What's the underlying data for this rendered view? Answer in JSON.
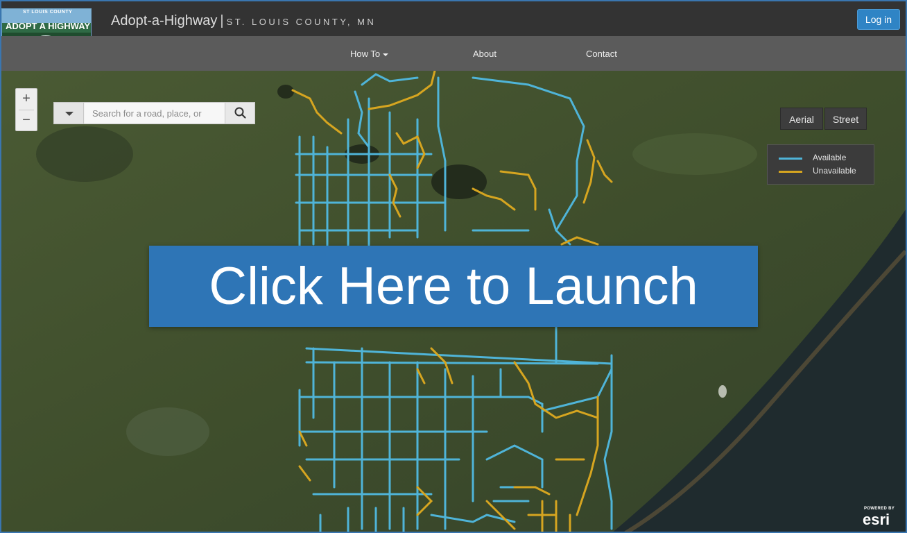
{
  "header": {
    "logo_top": "ST LOUIS COUNTY",
    "logo_main": "ADOPT A HIGHWAY",
    "title": "Adopt-a-Highway",
    "separator": "|",
    "subtitle": "St. Louis County, MN",
    "login_label": "Log in"
  },
  "nav": {
    "items": [
      {
        "label": "How To"
      },
      {
        "label": "About"
      },
      {
        "label": "Contact"
      }
    ]
  },
  "map": {
    "zoom_in": "+",
    "zoom_out": "−",
    "search_placeholder": "Search for a road, place, or",
    "basemap": {
      "aerial": "Aerial",
      "street": "Street"
    },
    "legend": [
      {
        "label": "Available",
        "color": "#4fb4d8"
      },
      {
        "label": "Unavailable",
        "color": "#d6a520"
      }
    ],
    "launch_label": "Click Here to Launch",
    "attribution": {
      "powered_by": "POWERED BY",
      "brand": "esri"
    }
  }
}
